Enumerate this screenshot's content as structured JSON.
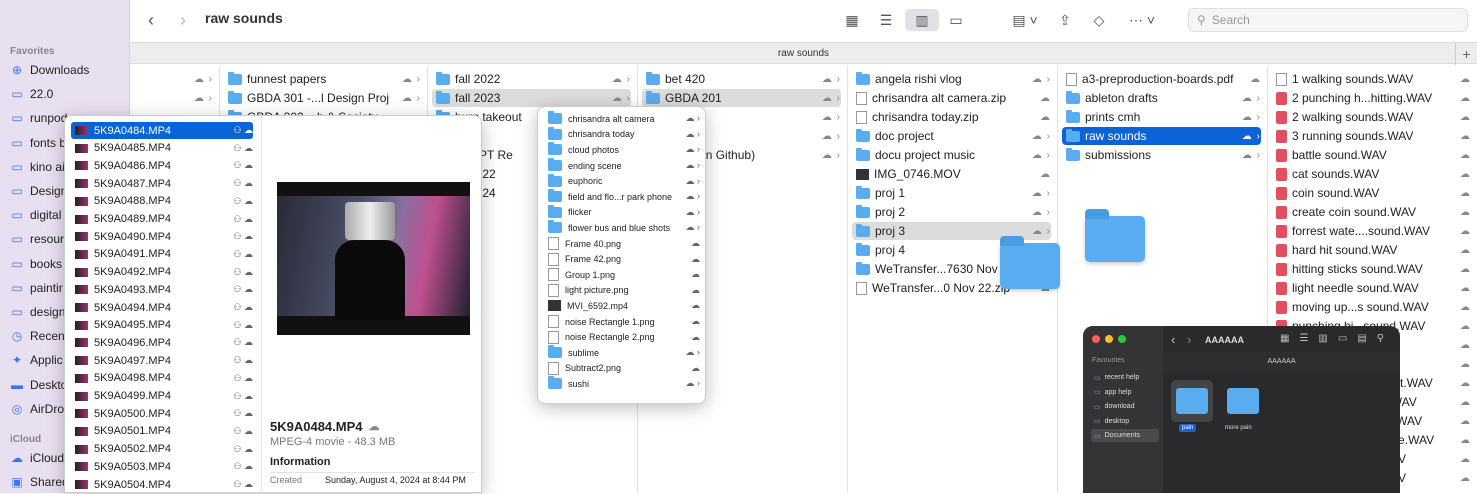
{
  "window": {
    "title": "raw sounds",
    "tab_title": "raw sounds"
  },
  "search": {
    "placeholder": "Search"
  },
  "sidebar": {
    "favorites_header": "Favorites",
    "favorites": [
      {
        "label": "Downloads",
        "icon": "download-icon"
      },
      {
        "label": "22.0",
        "icon": "folder-icon"
      },
      {
        "label": "runpod",
        "icon": "folder-icon"
      },
      {
        "label": "fonts b",
        "icon": "folder-icon"
      },
      {
        "label": "kino ai",
        "icon": "folder-icon"
      },
      {
        "label": "Design",
        "icon": "folder-icon"
      },
      {
        "label": "digital",
        "icon": "folder-icon"
      },
      {
        "label": "resour",
        "icon": "folder-icon"
      },
      {
        "label": "books",
        "icon": "folder-icon"
      },
      {
        "label": "paintir",
        "icon": "folder-icon"
      },
      {
        "label": "design",
        "icon": "folder-icon"
      },
      {
        "label": "Recen",
        "icon": "clock-icon"
      },
      {
        "label": "Applic",
        "icon": "apps-icon"
      },
      {
        "label": "Deskto",
        "icon": "desktop-icon"
      },
      {
        "label": "AirDro",
        "icon": "airdrop-icon"
      }
    ],
    "icloud_header": "iCloud",
    "icloud": [
      {
        "label": "iCloud",
        "icon": "cloud-icon"
      },
      {
        "label": "Shared",
        "icon": "shared-icon"
      }
    ]
  },
  "columns": {
    "col1": [
      {
        "name": "funnest papers",
        "kind": "folder"
      },
      {
        "name": "GBDA 301 -...l Design Proj",
        "kind": "folder"
      },
      {
        "name": "GBDA 302 ...h & Society",
        "kind": "folder"
      }
    ],
    "col2": [
      {
        "name": "fall 2022",
        "kind": "folder"
      },
      {
        "name": "fall 2023",
        "kind": "folder",
        "selected": "gray"
      },
      {
        "name": "burn takeout",
        "kind": "folder"
      },
      {
        "name": "q",
        "kind": "folder"
      },
      {
        "name": "TSRPT Re",
        "kind": "folder"
      },
      {
        "name": "er 2022",
        "kind": "folder"
      },
      {
        "name": "er 2024",
        "kind": "folder"
      }
    ],
    "col3": [
      {
        "name": "bet 420",
        "kind": "folder"
      },
      {
        "name": "GBDA 201",
        "kind": "folder",
        "selected": "gray"
      },
      {
        "name": "203",
        "kind": "folder"
      },
      {
        "name": "210",
        "kind": "folder"
      },
      {
        "name": "228 (non Github)",
        "kind": "folder"
      }
    ],
    "col4": [
      {
        "name": "angela rishi vlog",
        "kind": "folder"
      },
      {
        "name": "chrisandra alt camera.zip",
        "kind": "file"
      },
      {
        "name": "chrisandra today.zip",
        "kind": "file"
      },
      {
        "name": "doc project",
        "kind": "folder"
      },
      {
        "name": "docu project music",
        "kind": "folder"
      },
      {
        "name": "IMG_0746.MOV",
        "kind": "movie"
      },
      {
        "name": "proj 1",
        "kind": "folder"
      },
      {
        "name": "proj 2",
        "kind": "folder"
      },
      {
        "name": "proj 3",
        "kind": "folder",
        "selected": "gray"
      },
      {
        "name": "proj 4",
        "kind": "folder"
      },
      {
        "name": "WeTransfer...7630 Nov",
        "kind": "folder"
      },
      {
        "name": "WeTransfer...0 Nov 22.zip",
        "kind": "file"
      }
    ],
    "col5": [
      {
        "name": "a3-preproduction-boards.pdf",
        "kind": "file"
      },
      {
        "name": "ableton drafts",
        "kind": "folder"
      },
      {
        "name": "prints cmh",
        "kind": "folder"
      },
      {
        "name": "raw sounds",
        "kind": "folder",
        "selected": "blue"
      },
      {
        "name": "submissions",
        "kind": "folder"
      }
    ],
    "col6": [
      {
        "name": "1 walking sounds.WAV",
        "kind": "file"
      },
      {
        "name": "2 punching h...hitting.WAV",
        "kind": "wav"
      },
      {
        "name": "2 walking sounds.WAV",
        "kind": "wav"
      },
      {
        "name": "3 running sounds.WAV",
        "kind": "wav"
      },
      {
        "name": "battle sound.WAV",
        "kind": "wav"
      },
      {
        "name": "cat sounds.WAV",
        "kind": "wav"
      },
      {
        "name": "coin sound.WAV",
        "kind": "wav"
      },
      {
        "name": "create coin sound.WAV",
        "kind": "wav"
      },
      {
        "name": "forrest wate....sound.WAV",
        "kind": "wav"
      },
      {
        "name": "hard hit sound.WAV",
        "kind": "wav"
      },
      {
        "name": "hitting sticks sound.WAV",
        "kind": "wav"
      },
      {
        "name": "light needle sound.WAV",
        "kind": "wav"
      },
      {
        "name": "moving up...s sound.WAV",
        "kind": "wav"
      },
      {
        "name": "punching bi...sound.WAV",
        "kind": "wav"
      },
      {
        "name": "...sound.WAV",
        "kind": "wav"
      },
      {
        "name": "...sound.WAV",
        "kind": "wav"
      },
      {
        "name": "swoosh arro...and hit.WAV",
        "kind": "wav"
      },
      {
        "name": "swinging ne...light.WAV",
        "kind": "wav"
      },
      {
        "name": "unsheathing sword.WAV",
        "kind": "wav"
      },
      {
        "name": "wind and grass noise.WAV",
        "kind": "wav"
      },
      {
        "name": "ZOOM0079_LR.WAV",
        "kind": "wav"
      },
      {
        "name": "ZOOM0080_LR.WAV",
        "kind": "wav"
      }
    ]
  },
  "mp4_popup": {
    "files": [
      "5K9A0484.MP4",
      "5K9A0485.MP4",
      "5K9A0486.MP4",
      "5K9A0487.MP4",
      "5K9A0488.MP4",
      "5K9A0489.MP4",
      "5K9A0490.MP4",
      "5K9A0491.MP4",
      "5K9A0492.MP4",
      "5K9A0493.MP4",
      "5K9A0494.MP4",
      "5K9A0495.MP4",
      "5K9A0496.MP4",
      "5K9A0497.MP4",
      "5K9A0498.MP4",
      "5K9A0499.MP4",
      "5K9A0500.MP4",
      "5K9A0501.MP4",
      "5K9A0502.MP4",
      "5K9A0503.MP4",
      "5K9A0504.MP4"
    ],
    "preview": {
      "filename": "5K9A0484.MP4",
      "kind": "MPEG-4 movie - 48.3 MB",
      "info_header": "Information",
      "created_label": "Created",
      "created_value": "Sunday, August 4, 2024 at 8:44 PM"
    }
  },
  "small_popup": {
    "items": [
      {
        "name": "chrisandra alt camera",
        "kind": "folder"
      },
      {
        "name": "chrisandra today",
        "kind": "folder"
      },
      {
        "name": "cloud photos",
        "kind": "folder"
      },
      {
        "name": "ending scene",
        "kind": "folder"
      },
      {
        "name": "euphoric",
        "kind": "folder"
      },
      {
        "name": "field and flo...r park phone",
        "kind": "folder"
      },
      {
        "name": "flicker",
        "kind": "folder"
      },
      {
        "name": "flower bus and blue shots",
        "kind": "folder"
      },
      {
        "name": "Frame 40.png",
        "kind": "file"
      },
      {
        "name": "Frame 42.png",
        "kind": "file"
      },
      {
        "name": "Group 1.png",
        "kind": "file"
      },
      {
        "name": "light picture.png",
        "kind": "file"
      },
      {
        "name": "MVI_6592.mp4",
        "kind": "movie"
      },
      {
        "name": "noise Rectangle 1.png",
        "kind": "file"
      },
      {
        "name": "noise Rectangle 2.png",
        "kind": "file"
      },
      {
        "name": "sublime",
        "kind": "folder"
      },
      {
        "name": "Subtract2.png",
        "kind": "file"
      },
      {
        "name": "sushi",
        "kind": "folder"
      }
    ]
  },
  "dark_window": {
    "title": "AAAAAA",
    "path_title": "AAAAAA",
    "sidebar_header": "Favourites",
    "sidebar_items": [
      "recent help",
      "app help",
      "download",
      "desktop",
      "Documents"
    ],
    "folders": [
      "pain",
      "more pain"
    ]
  }
}
